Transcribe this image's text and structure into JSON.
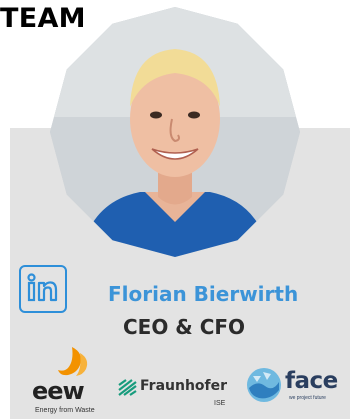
{
  "heading": "TEAM",
  "member": {
    "name": "Florian Bierwirth",
    "role": "CEO & CFO",
    "linkedin_icon": "linkedin-icon"
  },
  "logos": {
    "eew": {
      "word": "eew",
      "tagline": "Energy from Waste"
    },
    "fraunhofer": {
      "word": "Fraunhofer",
      "sub": "ISE"
    },
    "face": {
      "word": "face",
      "tagline": "we project future"
    }
  },
  "colors": {
    "card": "#e3e3e3",
    "name": "#3c94d8",
    "role": "#2b2b2b",
    "linkedin": "#2e8fd9",
    "eew_flame": "#f39200",
    "fraunhofer": "#179c7d",
    "face": "#2a3e5f"
  }
}
